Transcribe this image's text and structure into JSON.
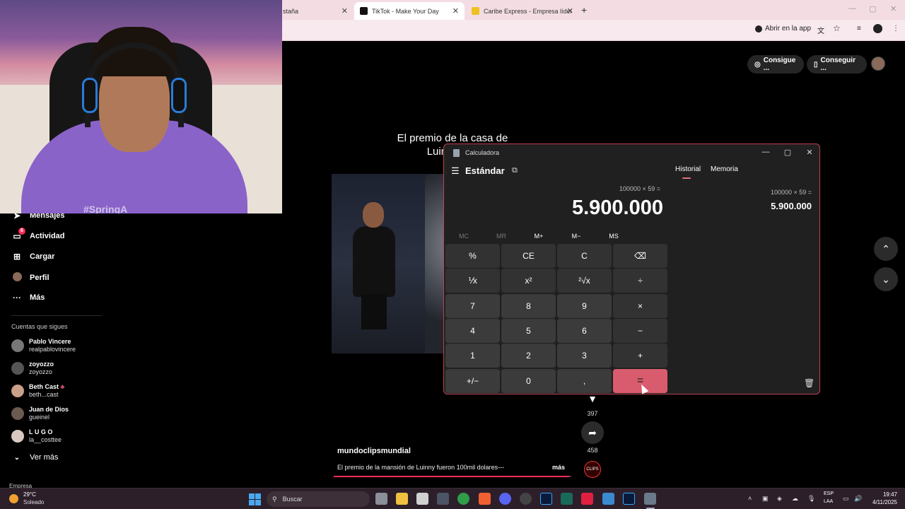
{
  "browser": {
    "tabs": [
      {
        "label": "staña"
      },
      {
        "label": "TikTok - Make Your Day"
      },
      {
        "label": "Caribe Express - Empresa líder"
      }
    ],
    "open_in_app": "Abrir en la app"
  },
  "tiktok": {
    "top_pills": [
      "Consigue ...",
      "Conseguir ..."
    ],
    "nav": [
      {
        "label": "Mensajes",
        "icon": "send-icon"
      },
      {
        "label": "Actividad",
        "icon": "inbox-icon",
        "badge": "6"
      },
      {
        "label": "Cargar",
        "icon": "upload-icon"
      },
      {
        "label": "Perfil",
        "icon": "profile-icon"
      },
      {
        "label": "Más",
        "icon": "more-icon"
      }
    ],
    "following_title": "Cuentas que sigues",
    "following": [
      {
        "name": "Pablo Vincere",
        "handle": "realpablovincere"
      },
      {
        "name": "zoyozzo",
        "handle": "zoyozzo"
      },
      {
        "name": "Beth Cast",
        "handle": "beth...cast"
      },
      {
        "name": "Juan de Dios",
        "handle": "gueinel"
      },
      {
        "name": "L U G O",
        "handle": "la__costtee"
      }
    ],
    "see_more": "Ver más",
    "footer_cut": "Empresa",
    "video_caption": "El premio de la casa de Luinny son",
    "video_overlay_text": "#SpringA",
    "actions": {
      "bookmarks": "397",
      "shares": "458"
    },
    "author": "mundoclipsmundial",
    "description": "El premio de la mansión de Luinny fueron 100mil dolares---",
    "more": "más",
    "progress": 0.99
  },
  "calculator": {
    "title": "Calculadora",
    "mode": "Estándar",
    "expression": "100000 × 59 =",
    "result": "5.900.000",
    "memory_buttons": [
      "MC",
      "MR",
      "M+",
      "M−",
      "MS"
    ],
    "keys": [
      [
        "%",
        "CE",
        "C",
        "⌫"
      ],
      [
        "⅟x",
        "x²",
        "²√x",
        "÷"
      ],
      [
        "7",
        "8",
        "9",
        "×"
      ],
      [
        "4",
        "5",
        "6",
        "−"
      ],
      [
        "1",
        "2",
        "3",
        "+"
      ],
      [
        "+/−",
        "0",
        ",",
        "="
      ]
    ],
    "side_tabs": [
      "Historial",
      "Memoria"
    ],
    "history": {
      "expression": "100000   ×   59 =",
      "result": "5.900.000"
    }
  },
  "taskbar": {
    "temp": "29°C",
    "condition": "Soleado",
    "search": "Buscar",
    "lang1": "ESP",
    "lang2": "LAA",
    "time": "19:47",
    "date": "4/11/2025"
  },
  "colors": {
    "tiktok_red": "#fe2c55",
    "calc_accent": "#d95c6e",
    "tab_bar": "#f3dde3"
  }
}
